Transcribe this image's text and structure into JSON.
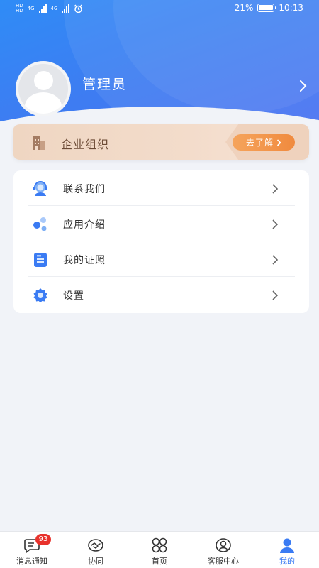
{
  "status_bar": {
    "battery": "21%",
    "time": "10:13",
    "network_a": "4G",
    "network_b": "4G",
    "hd": "HD"
  },
  "profile": {
    "username": "管理员"
  },
  "org_banner": {
    "label": "企业组织",
    "button_label": "去了解"
  },
  "menu": {
    "items": [
      {
        "label": "联系我们",
        "icon": "headset-icon"
      },
      {
        "label": "应用介绍",
        "icon": "app-intro-icon"
      },
      {
        "label": "我的证照",
        "icon": "certificate-icon"
      },
      {
        "label": "设置",
        "icon": "settings-gear-icon"
      }
    ]
  },
  "tab_bar": {
    "items": [
      {
        "label": "消息通知",
        "icon": "message-icon",
        "badge": "93"
      },
      {
        "label": "协同",
        "icon": "handshake-icon"
      },
      {
        "label": "首页",
        "icon": "home-grid-icon"
      },
      {
        "label": "客服中心",
        "icon": "customer-service-icon"
      },
      {
        "label": "我的",
        "icon": "user-profile-icon",
        "active": true
      }
    ]
  },
  "colors": {
    "header_blue": "#3d7df2",
    "accent_orange": "#f08a3e",
    "active_tab": "#3a7bf3",
    "badge_red": "#e8322c"
  }
}
